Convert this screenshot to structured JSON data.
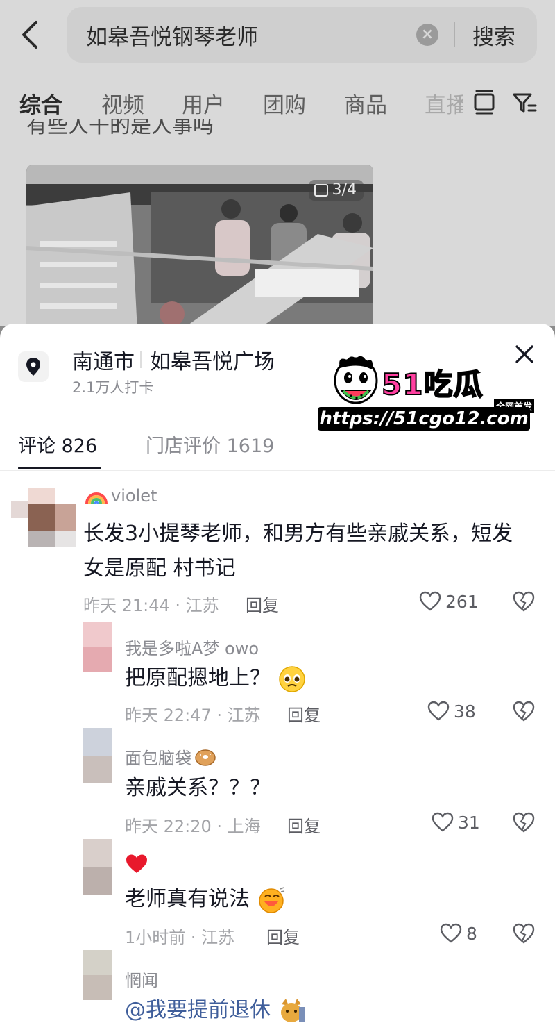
{
  "search": {
    "query": "如皋吾悦钢琴老师",
    "button": "搜索"
  },
  "tabs": [
    {
      "label": "综合"
    },
    {
      "label": "视频"
    },
    {
      "label": "用户"
    },
    {
      "label": "团购"
    },
    {
      "label": "商品"
    },
    {
      "label": "直播"
    }
  ],
  "feed": {
    "title_fragment": "有些人干的是人事吗",
    "photo_count": "3/4"
  },
  "location": {
    "city": "南通市",
    "place": "如皋吾悦广场",
    "checkins": "2.1万人打卡"
  },
  "watermark": {
    "brand": "51吃瓜",
    "tag": "全网首发",
    "url": "https://51cgo12.com"
  },
  "sheet_tabs": {
    "comments": "评论 826",
    "reviews": "门店评价 1619"
  },
  "comments": [
    {
      "user": "violet",
      "text": "长发3小提琴老师，和男方有些亲戚关系，短发女是原配 村书记",
      "meta": "昨天 21:44 · 江苏",
      "reply": "回复",
      "likes": "261",
      "icon": "rainbow-icon"
    },
    {
      "user": "我是多啦A梦 owo",
      "text": "把原配摁地上？",
      "meta": "昨天 22:47 · 江苏",
      "reply": "回复",
      "likes": "38",
      "icon": "pleading-face-emoji"
    },
    {
      "user": "面包脑袋",
      "text": "亲戚关系？？？",
      "meta": "昨天 22:20 · 上海",
      "reply": "回复",
      "likes": "31",
      "icon": "bagel-emoji"
    },
    {
      "user": "",
      "text": "老师真有说法",
      "meta": "1小时前 · 江苏",
      "reply": "回复",
      "likes": "8",
      "icon": "heart-emoji"
    },
    {
      "user": "惘闻",
      "text": "@我要提前退休",
      "icon": "cat-emoji"
    }
  ],
  "colors": {
    "text_primary": "#161823",
    "text_secondary": "#8a8b91",
    "mention": "#3f5e9b",
    "watermark_pink": "#ff3fa0"
  }
}
